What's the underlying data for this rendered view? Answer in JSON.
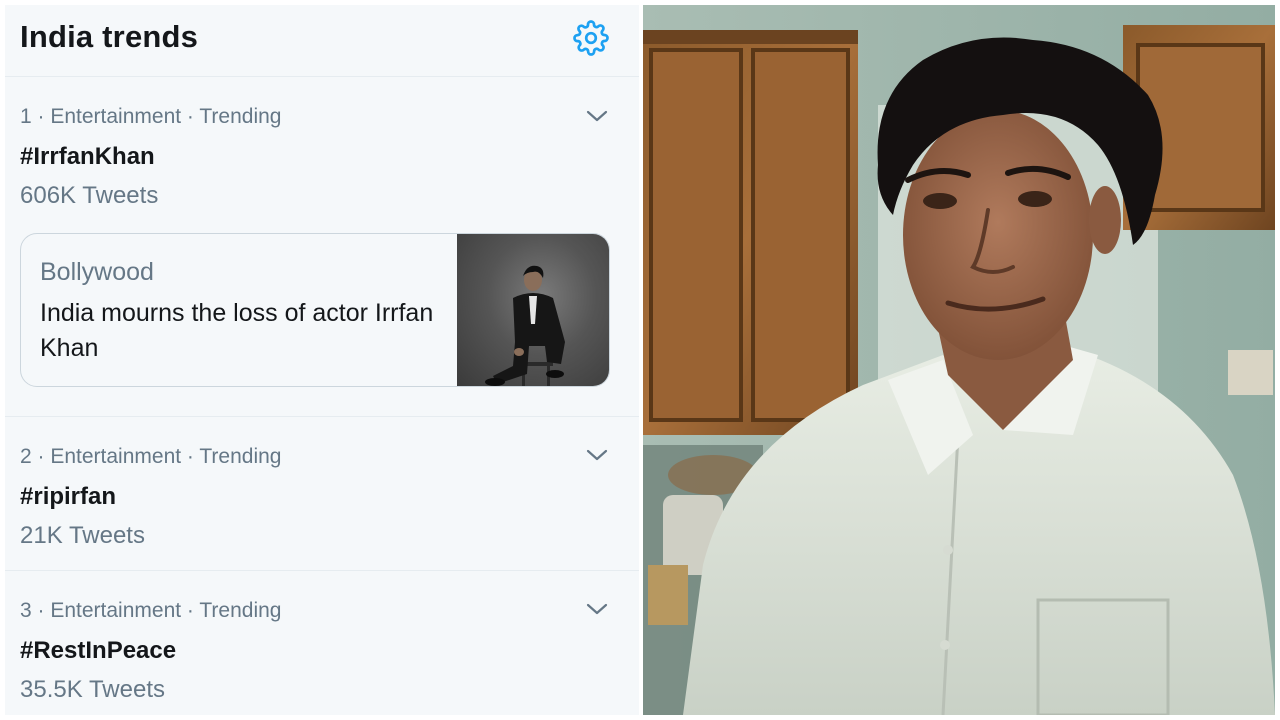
{
  "panel": {
    "title": "India trends",
    "settings_icon": "gear-icon"
  },
  "trends": [
    {
      "rank_meta": "1 · Entertainment · Trending",
      "name": "#IrrfanKhan",
      "count": "606K Tweets"
    },
    {
      "rank_meta": "2 · Entertainment · Trending",
      "name": "#ripirfan",
      "count": "21K Tweets"
    },
    {
      "rank_meta": "3 · Entertainment · Trending",
      "name": "#RestInPeace",
      "count": "35.5K Tweets"
    }
  ],
  "card": {
    "category": "Bollywood",
    "headline": "India mourns the loss of actor Irrfan Khan"
  },
  "colors": {
    "accent": "#1da1f2",
    "panel_bg": "#f5f8fa",
    "text_primary": "#14171a",
    "text_secondary": "#657786"
  }
}
